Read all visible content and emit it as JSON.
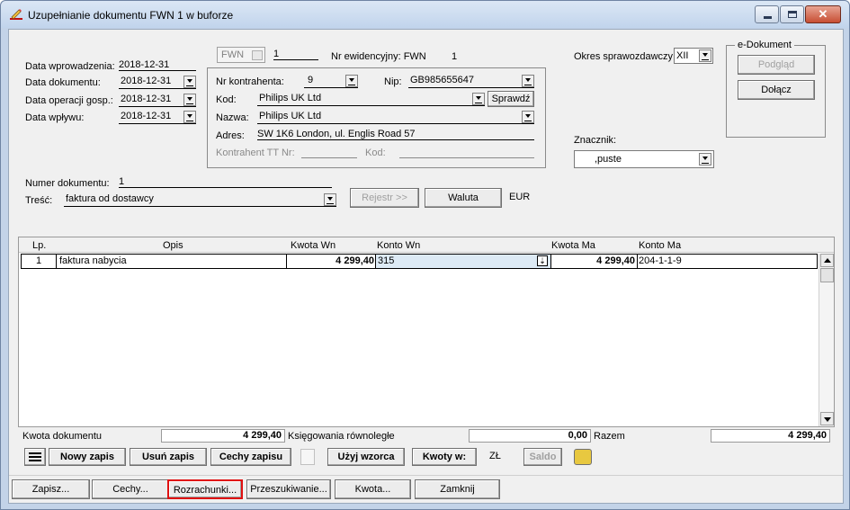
{
  "window": {
    "title": "Uzupełnianie dokumentu FWN 1 w buforze",
    "minimize_icon": "minimize-icon",
    "maximize_icon": "maximize-icon",
    "close_icon": "close-icon"
  },
  "doc": {
    "type": "FWN",
    "number": "1",
    "nr_ewid_label": "Nr ewidencyjny: FWN",
    "nr_ewid_value": "1",
    "okres_label": "Okres sprawozdawczy:",
    "okres_value": "XII"
  },
  "dates": {
    "wprowadzenia_label": "Data wprowadzenia:",
    "wprowadzenia_value": "2018-12-31",
    "dokumentu_label": "Data dokumentu:",
    "dokumentu_value": "2018-12-31",
    "operacji_label": "Data operacji gosp.:",
    "operacji_value": "2018-12-31",
    "wplywu_label": "Data wpływu:",
    "wplywu_value": "2018-12-31"
  },
  "contractor": {
    "nr_label": "Nr kontrahenta:",
    "nr_value": "9",
    "nip_label": "Nip:",
    "nip_value": "GB985655647",
    "kod_label": "Kod:",
    "kod_value": "Philips UK Ltd",
    "sprawdz_label": "Sprawdź",
    "nazwa_label": "Nazwa:",
    "nazwa_value": "Philips UK Ltd",
    "adres_label": "Adres:",
    "adres_value": "SW 1K6 London, ul. Englis Road 57",
    "tt_label": "Kontrahent TT Nr:",
    "tt_kod_label": "Kod:"
  },
  "edoc": {
    "group_label": "e-Dokument",
    "podglad_label": "Podgląd",
    "dolacz_label": "Dołącz"
  },
  "znacznik": {
    "label": "Znacznik:",
    "value": ",puste"
  },
  "document": {
    "numer_label": "Numer dokumentu:",
    "numer_value": "1",
    "tresc_label": "Treść:",
    "tresc_value": "faktura od dostawcy",
    "rejestr_label": "Rejestr >>",
    "waluta_label": "Waluta",
    "currency": "EUR"
  },
  "grid": {
    "columns": [
      "Lp.",
      "Opis",
      "Kwota Wn",
      "Konto Wn",
      "Kwota Ma",
      "Konto Ma"
    ],
    "rows": [
      {
        "lp": "1",
        "opis": "faktura nabycia",
        "kwota_wn": "4 299,40",
        "konto_wn": "315",
        "kwota_ma": "4 299,40",
        "konto_ma": "204-1-1-9"
      }
    ]
  },
  "totals": {
    "kwota_dokumentu_label": "Kwota dokumentu",
    "kwota_dokumentu_value": "4 299,40",
    "ksiegowania_label": "Księgowania równoległe",
    "ksiegowania_value": "0,00",
    "razem_label": "Razem",
    "razem_value": "4 299,40"
  },
  "toolbar": {
    "menu_icon": "list-icon",
    "nowy_zapis": "Nowy zapis",
    "usun_zapis": "Usuń zapis",
    "cechy_zapisu": "Cechy zapisu",
    "uzyj_wzorca": "Użyj wzorca",
    "kwoty_w": "Kwoty w:",
    "currency": "ZŁ",
    "saldo": "Saldo"
  },
  "bottom": {
    "zapisz": "Zapisz...",
    "cechy": "Cechy...",
    "rozrachunki": "Rozrachunki...",
    "przeszukiwanie": "Przeszukiwanie...",
    "kwota": "Kwota...",
    "zamknij": "Zamknij"
  },
  "colors": {
    "highlight_border": "#e01010",
    "title_bar": "#c1d4ec",
    "dialog_bg": "#f0f0f0"
  }
}
